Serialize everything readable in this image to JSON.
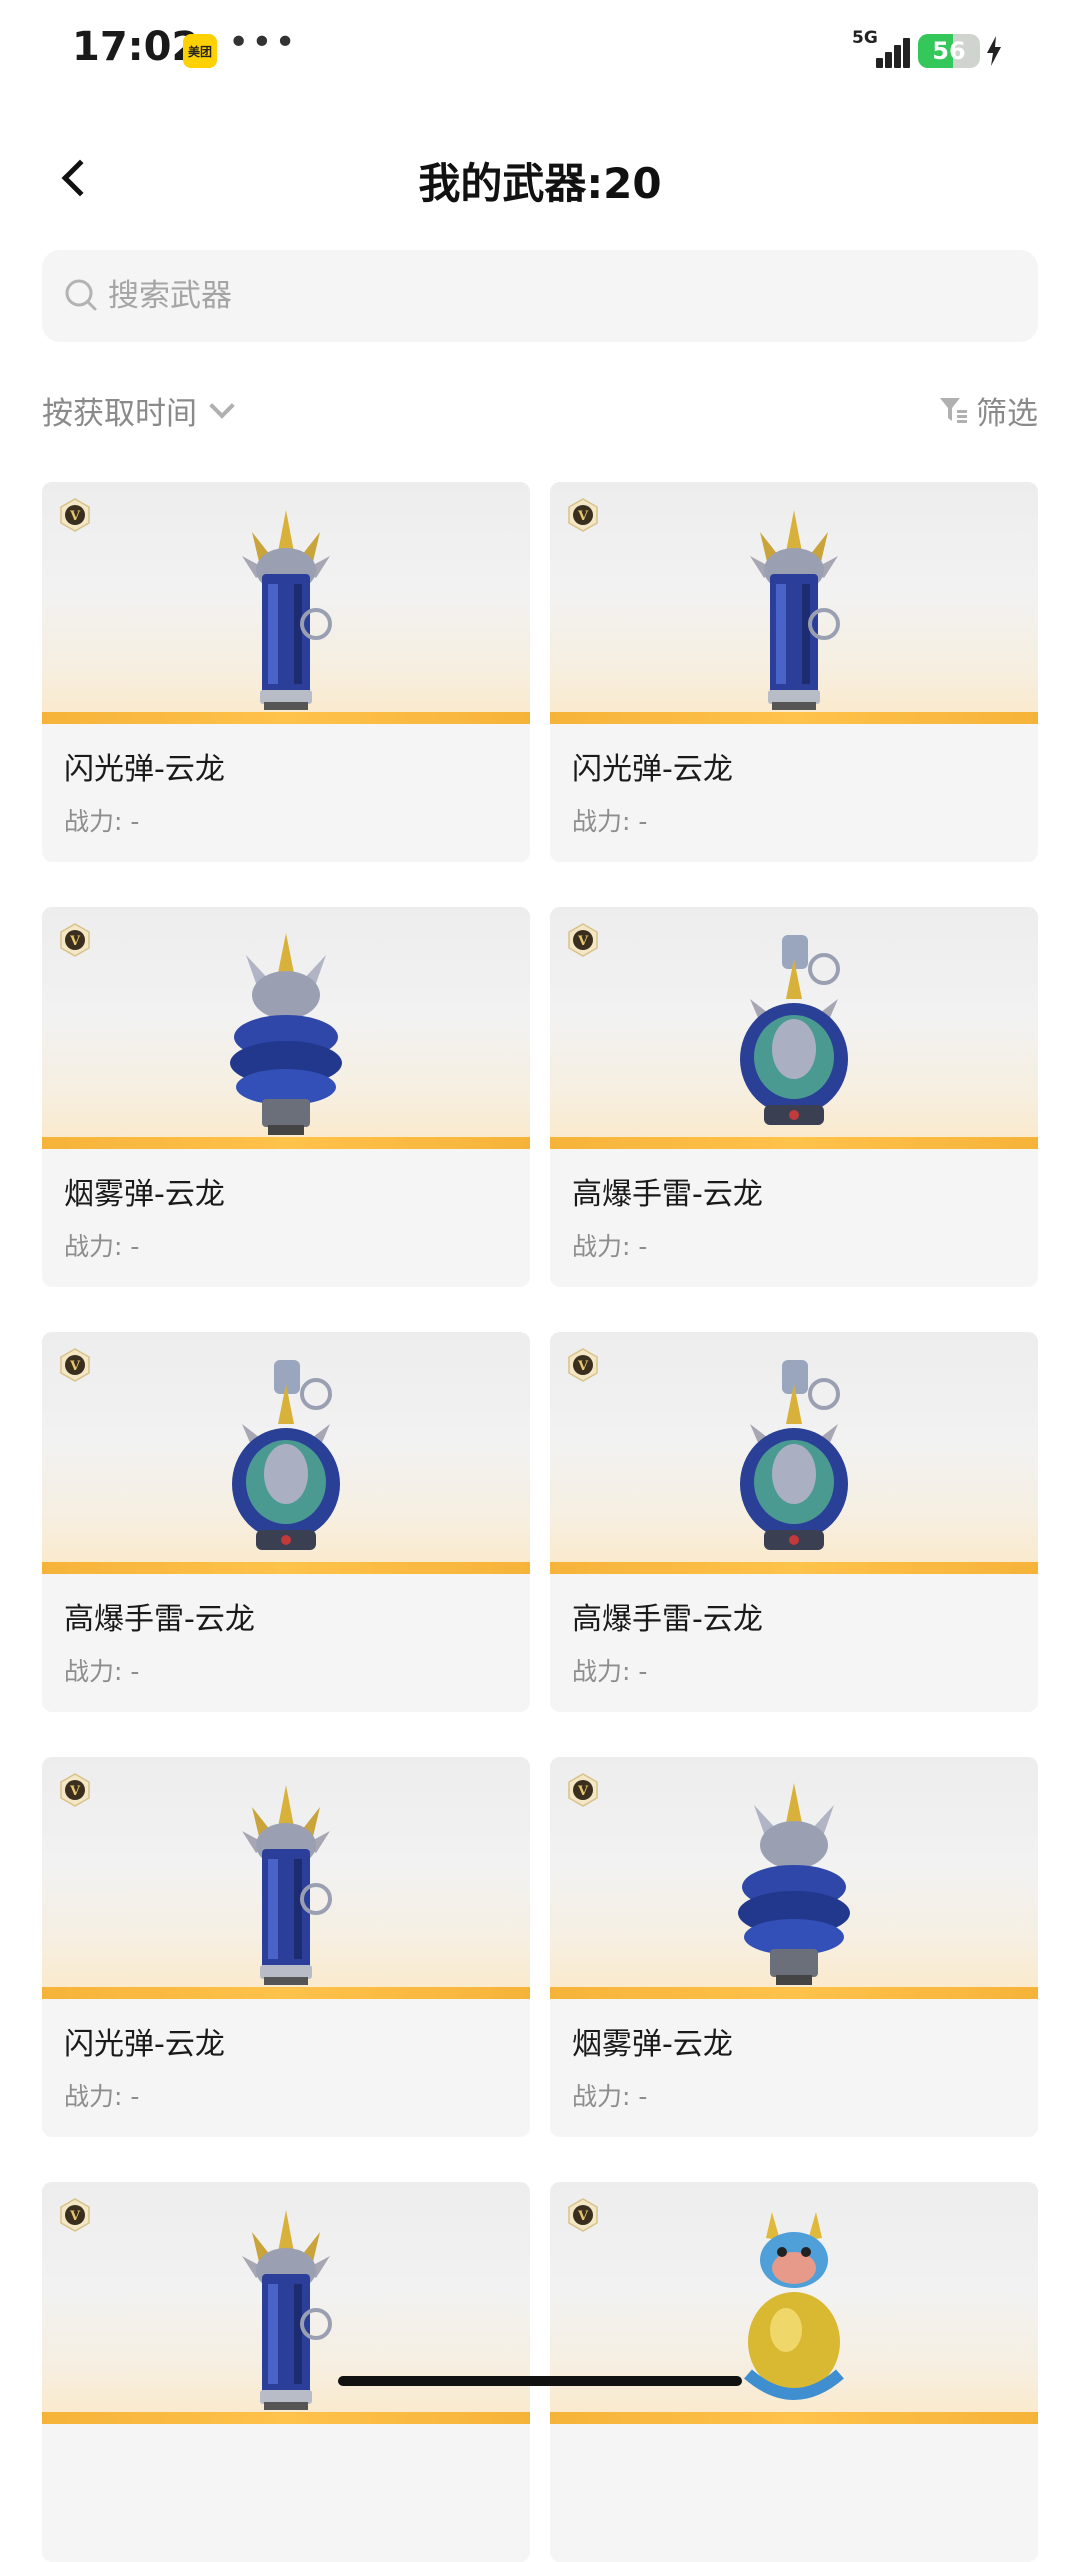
{
  "status_bar": {
    "time": "17:02",
    "app_badge": "美团",
    "more": "•••",
    "network": "5G",
    "battery_level": 56,
    "battery_text": "56"
  },
  "header": {
    "title": "我的武器:20",
    "back_icon": "chevron-left-icon"
  },
  "search": {
    "placeholder": "搜索武器",
    "value": ""
  },
  "toolbar": {
    "sort_label": "按获取时间",
    "filter_label": "筛选"
  },
  "colors": {
    "accent_stripe": "#f6b33a",
    "card_bg": "#f5f5f5",
    "muted_text": "#8d8d8d",
    "battery_green": "#34c759"
  },
  "weapons": [
    {
      "name": "闪光弹-云龙",
      "power": "战力: -",
      "icon": "flashbang-icon"
    },
    {
      "name": "闪光弹-云龙",
      "power": "战力: -",
      "icon": "flashbang-icon"
    },
    {
      "name": "烟雾弹-云龙",
      "power": "战力: -",
      "icon": "smoke-grenade-icon"
    },
    {
      "name": "高爆手雷-云龙",
      "power": "战力: -",
      "icon": "frag-grenade-icon"
    },
    {
      "name": "高爆手雷-云龙",
      "power": "战力: -",
      "icon": "frag-grenade-icon"
    },
    {
      "name": "高爆手雷-云龙",
      "power": "战力: -",
      "icon": "frag-grenade-icon"
    },
    {
      "name": "闪光弹-云龙",
      "power": "战力: -",
      "icon": "flashbang-icon"
    },
    {
      "name": "烟雾弹-云龙",
      "power": "战力: -",
      "icon": "smoke-grenade-icon"
    },
    {
      "name": "",
      "power": "",
      "icon": "flashbang-icon"
    },
    {
      "name": "",
      "power": "",
      "icon": "dragon-mascot-icon"
    }
  ]
}
